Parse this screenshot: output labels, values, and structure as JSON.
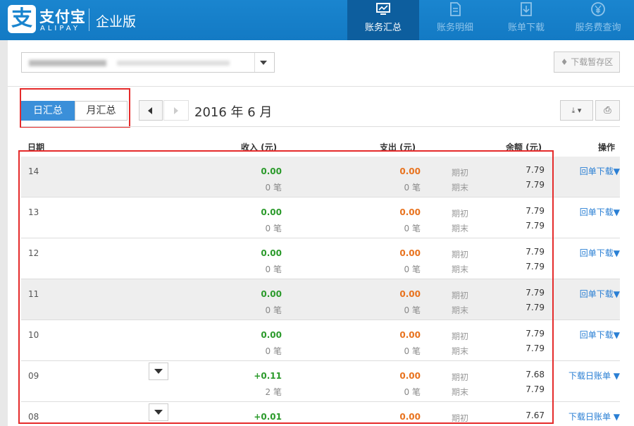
{
  "header": {
    "logo_glyph": "支",
    "brand_cn": "支付宝",
    "brand_en": "ALIPAY",
    "edition": "企业版",
    "tabs": [
      {
        "label": "账务汇总",
        "icon": "monitor-icon",
        "active": true
      },
      {
        "label": "账务明细",
        "icon": "document-icon",
        "active": false
      },
      {
        "label": "账单下载",
        "icon": "download-icon",
        "active": false
      },
      {
        "label": "服务费查询",
        "icon": "yen-icon",
        "active": false
      }
    ]
  },
  "toolbar": {
    "download_area_label": "下载暂存区"
  },
  "filters": {
    "day_label": "日汇总",
    "month_label": "月汇总",
    "period": "2016 年 6 月",
    "export_glyph": "⤓ ▾",
    "print_glyph": "⎙"
  },
  "table": {
    "headers": {
      "date": "日期",
      "income": "收入 (元)",
      "expense": "支出 (元)",
      "balance": "余额 (元)",
      "action": "操作"
    },
    "rows": [
      {
        "date": "14",
        "income": "0.00",
        "income_count": "0 笔",
        "expense": "0.00",
        "expense_count": "0 笔",
        "open_label": "期初",
        "open_value": "7.79",
        "close_label": "期末",
        "close_value": "7.79",
        "action": "回单下载▼"
      },
      {
        "date": "13",
        "income": "0.00",
        "income_count": "0 笔",
        "expense": "0.00",
        "expense_count": "0 笔",
        "open_label": "期初",
        "open_value": "7.79",
        "close_label": "期末",
        "close_value": "7.79",
        "action": "回单下载▼"
      },
      {
        "date": "12",
        "income": "0.00",
        "income_count": "0 笔",
        "expense": "0.00",
        "expense_count": "0 笔",
        "open_label": "期初",
        "open_value": "7.79",
        "close_label": "期末",
        "close_value": "7.79",
        "action": "回单下载▼"
      },
      {
        "date": "11",
        "income": "0.00",
        "income_count": "0 笔",
        "expense": "0.00",
        "expense_count": "0 笔",
        "open_label": "期初",
        "open_value": "7.79",
        "close_label": "期末",
        "close_value": "7.79",
        "action": "回单下载▼"
      },
      {
        "date": "10",
        "income": "0.00",
        "income_count": "0 笔",
        "expense": "0.00",
        "expense_count": "0 笔",
        "open_label": "期初",
        "open_value": "7.79",
        "close_label": "期末",
        "close_value": "7.79",
        "action": "回单下载▼"
      },
      {
        "date": "09",
        "income": "+0.11",
        "income_count": "2 笔",
        "expense": "0.00",
        "expense_count": "0 笔",
        "open_label": "期初",
        "open_value": "7.68",
        "close_label": "期末",
        "close_value": "7.79",
        "action": "下载日账单 ▼"
      },
      {
        "date": "08",
        "income": "+0.01",
        "income_count": "",
        "expense": "0.00",
        "expense_count": "",
        "open_label": "期初",
        "open_value": "7.67",
        "close_label": "",
        "close_value": "",
        "action": "下载日账单 ▼"
      }
    ]
  }
}
